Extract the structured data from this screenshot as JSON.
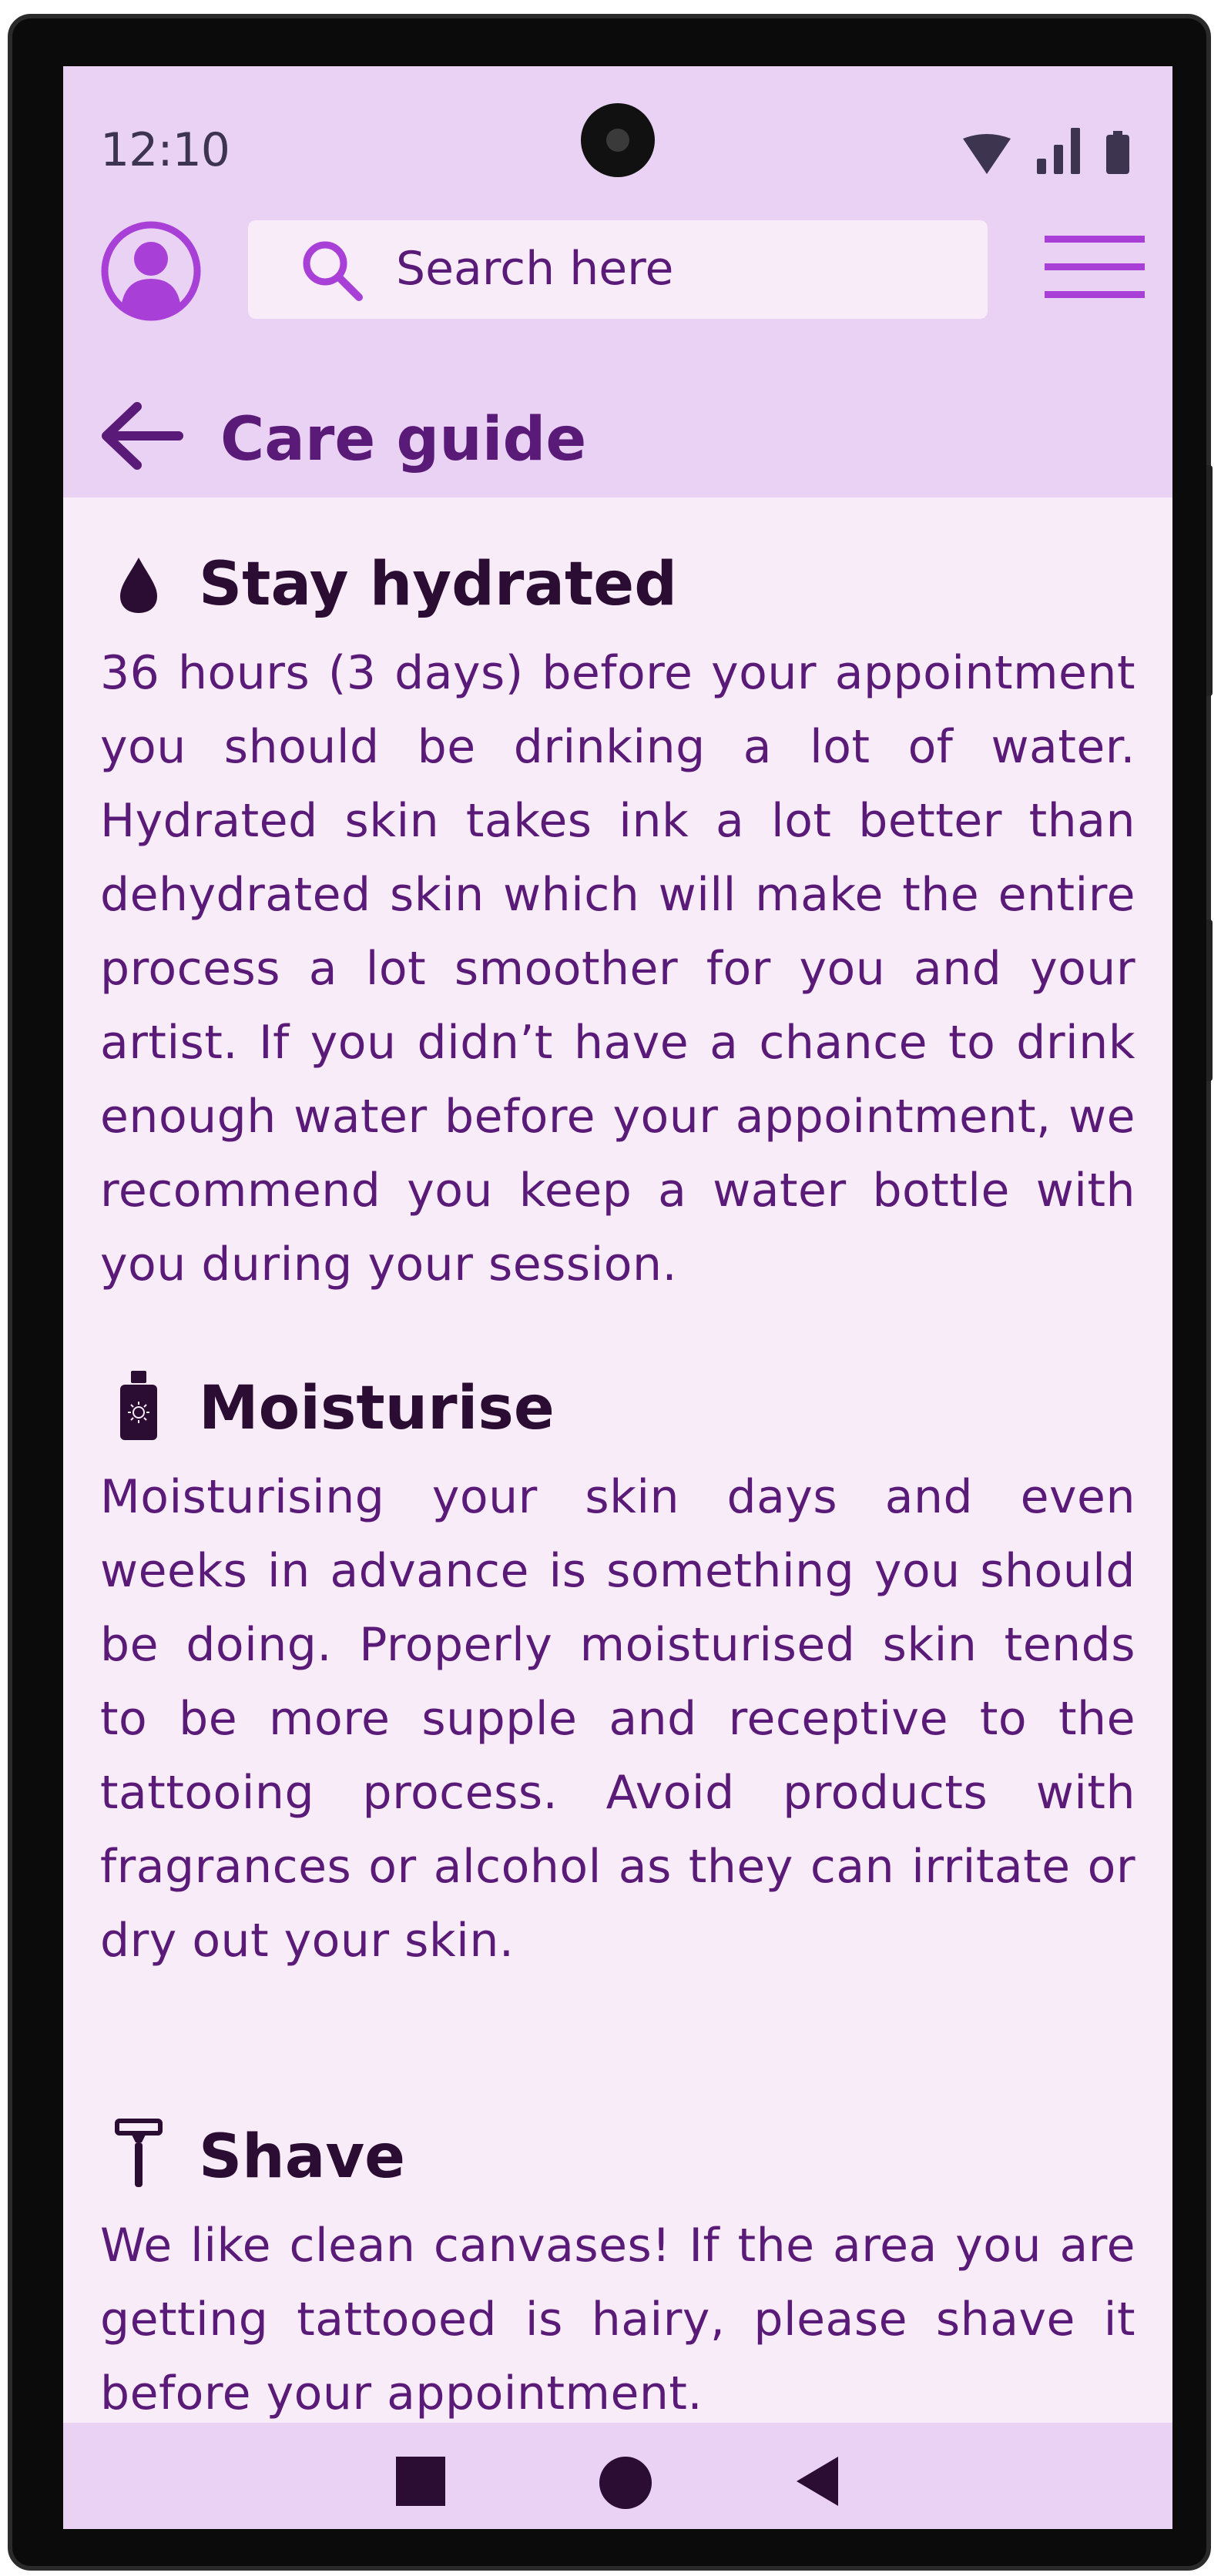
{
  "status_bar": {
    "time": "12:10",
    "icons": [
      "wifi-icon",
      "signal-icon",
      "battery-icon"
    ]
  },
  "header": {
    "avatar_icon": "user-avatar-icon",
    "search": {
      "placeholder": "Search here",
      "icon": "search-icon"
    },
    "menu_icon": "hamburger-menu-icon",
    "back_icon": "arrow-left-icon",
    "title": "Care guide"
  },
  "sections": [
    {
      "icon": "water-drop-icon",
      "title": "Stay hydrated",
      "body": "36 hours (3 days) before your appointment you should be drinking a lot of water. Hydrated skin takes ink a lot better than dehydrated skin which will make the entire process a lot smoother for you and your artist. If you didn’t have a chance to drink enough water before your appointment, we recommend you keep a water bottle with you during your session."
    },
    {
      "icon": "sunscreen-bottle-icon",
      "title": "Moisturise",
      "body": "Moisturising your skin days and even weeks in advance is something you should be doing. Properly moisturised skin tends to be more supple and receptive to the tattooing process. Avoid products with fragrances or alcohol as they can irritate or dry out your skin."
    },
    {
      "icon": "razor-icon",
      "title": "Shave",
      "body": "We like clean canvases! If the area you are getting tattooed is hairy, please shave it before your appointment."
    }
  ],
  "nav_bar": {
    "buttons": [
      "recents-square-icon",
      "home-circle-icon",
      "back-triangle-icon"
    ]
  },
  "colors": {
    "app_bar": "#ead2f4",
    "background": "#f9ecf9",
    "accent": "#a83fd6",
    "primary_text": "#5a1a78",
    "heading_text": "#2b0d33"
  }
}
